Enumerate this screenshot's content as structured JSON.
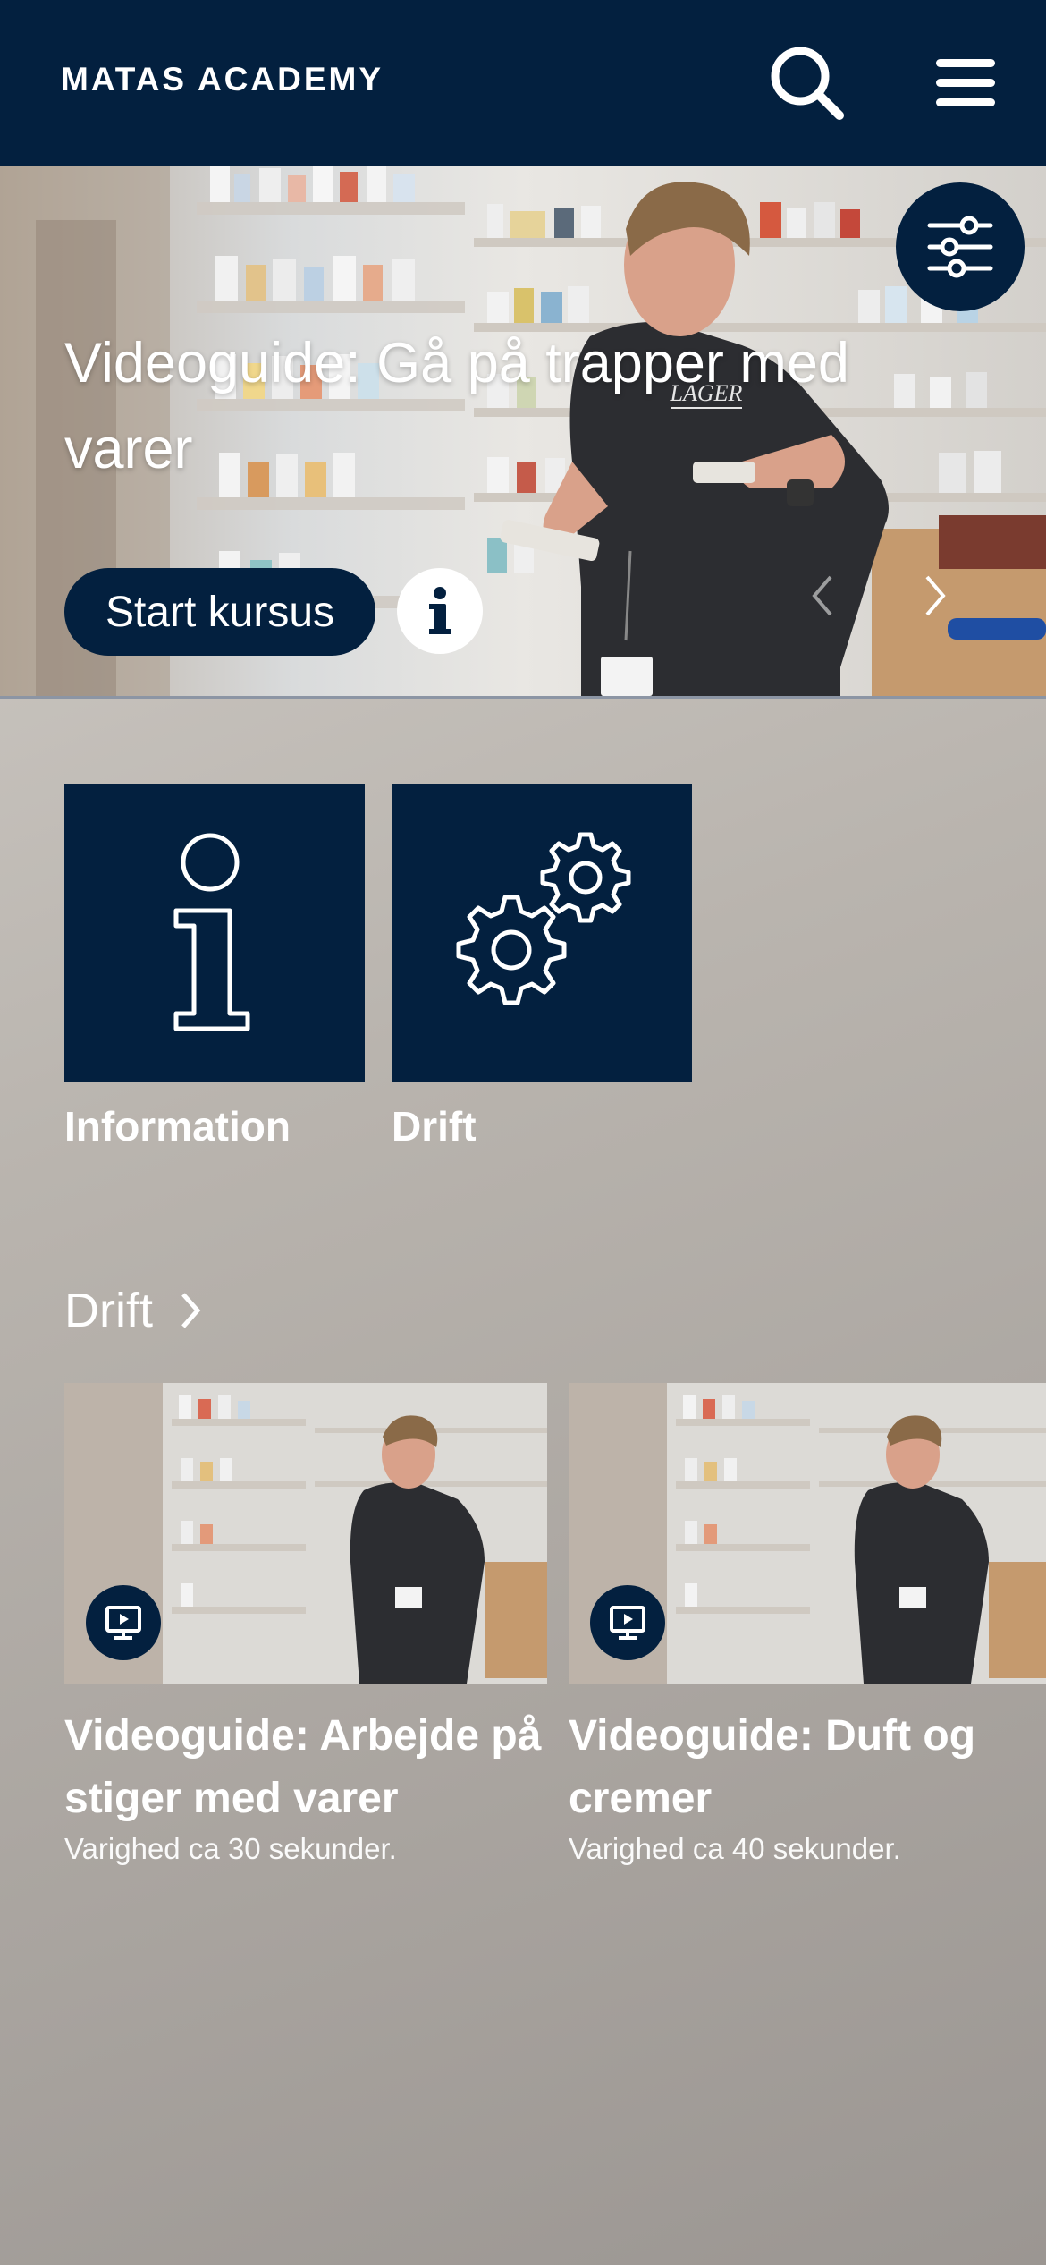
{
  "header": {
    "brand": "MATAS ACADEMY",
    "search_icon": "search-icon",
    "menu_icon": "hamburger-menu-icon",
    "background": "#03203f"
  },
  "hero": {
    "title": "Videoguide: Gå på trapper med varer",
    "start_label": "Start kursus",
    "info_icon": "info-icon",
    "filter_icon": "sliders-icon",
    "prev_icon": "chevron-left-icon",
    "next_icon": "chevron-right-icon",
    "shirt_text": "LAGER"
  },
  "categories": [
    {
      "label": "Information",
      "icon": "info-icon"
    },
    {
      "label": "Drift",
      "icon": "gears-icon"
    }
  ],
  "section": {
    "title": "Drift",
    "chevron_icon": "chevron-right-icon",
    "cards": [
      {
        "title": "Videoguide: Arbejde på stiger med varer",
        "subtitle": "Varighed ca 30 sekunder.",
        "badge_icon": "video-play-icon"
      },
      {
        "title": "Videoguide: Duft og cremer",
        "subtitle": "Varighed ca 40 sekunder.",
        "badge_icon": "video-play-icon"
      }
    ]
  },
  "colors": {
    "navy": "#03203f",
    "accent_white": "#ffffff"
  }
}
